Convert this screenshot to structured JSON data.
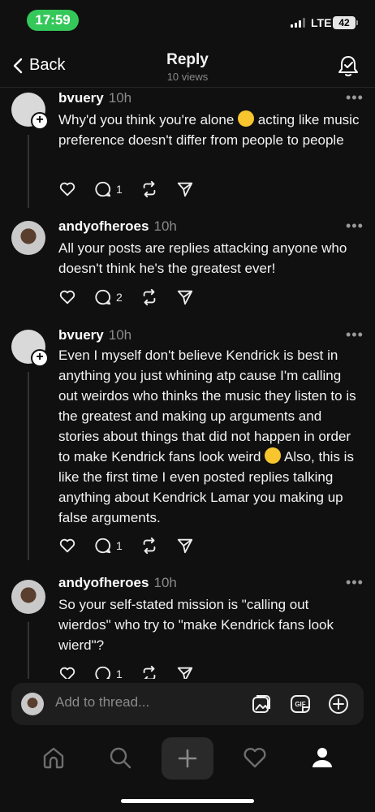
{
  "status_bar": {
    "time": "17:59",
    "network": "LTE",
    "battery": "42"
  },
  "header": {
    "back_label": "Back",
    "title": "Reply",
    "views": "10 views"
  },
  "posts": [
    {
      "username": "bvuery",
      "time": "10h",
      "text": "Why'd you think you're alone",
      "text_after_emoji": " acting like music preference doesn't differ from people to people",
      "emoji": "crying-face",
      "reply_count": "1",
      "has_follow_badge": true
    },
    {
      "username": "andyofheroes",
      "time": "10h",
      "text": "All your posts are replies attacking anyone who doesn't think he's the greatest ever!",
      "reply_count": "2",
      "has_follow_badge": false
    },
    {
      "username": "bvuery",
      "time": "10h",
      "text": "Even I myself don't believe Kendrick is best in anything you just whining atp cause I'm calling out weirdos who thinks the music they listen to is the greatest and making up arguments and stories about things that did not happen in order to make Kendrick fans look weird",
      "text_after_emoji": "Also, this is like the first time I even posted replies talking anything about Kendrick Lamar you making up false arguments.",
      "emoji": "rolling-on-floor-laughing",
      "reply_count": "1",
      "has_follow_badge": true
    },
    {
      "username": "andyofheroes",
      "time": "10h",
      "text": "So your self-stated mission is \"calling out wierdos\" who try to \"make Kendrick fans look wierd\"?",
      "reply_count": "1",
      "has_follow_badge": false
    }
  ],
  "composer": {
    "placeholder": "Add to thread..."
  },
  "bottom_nav": [
    "home-icon",
    "search-icon",
    "compose-plus-icon",
    "heart-icon",
    "profile-icon"
  ],
  "colors": {
    "background": "#101010",
    "status_green": "#34c759",
    "text": "#f3f3f3",
    "muted": "#8a8a8a"
  }
}
